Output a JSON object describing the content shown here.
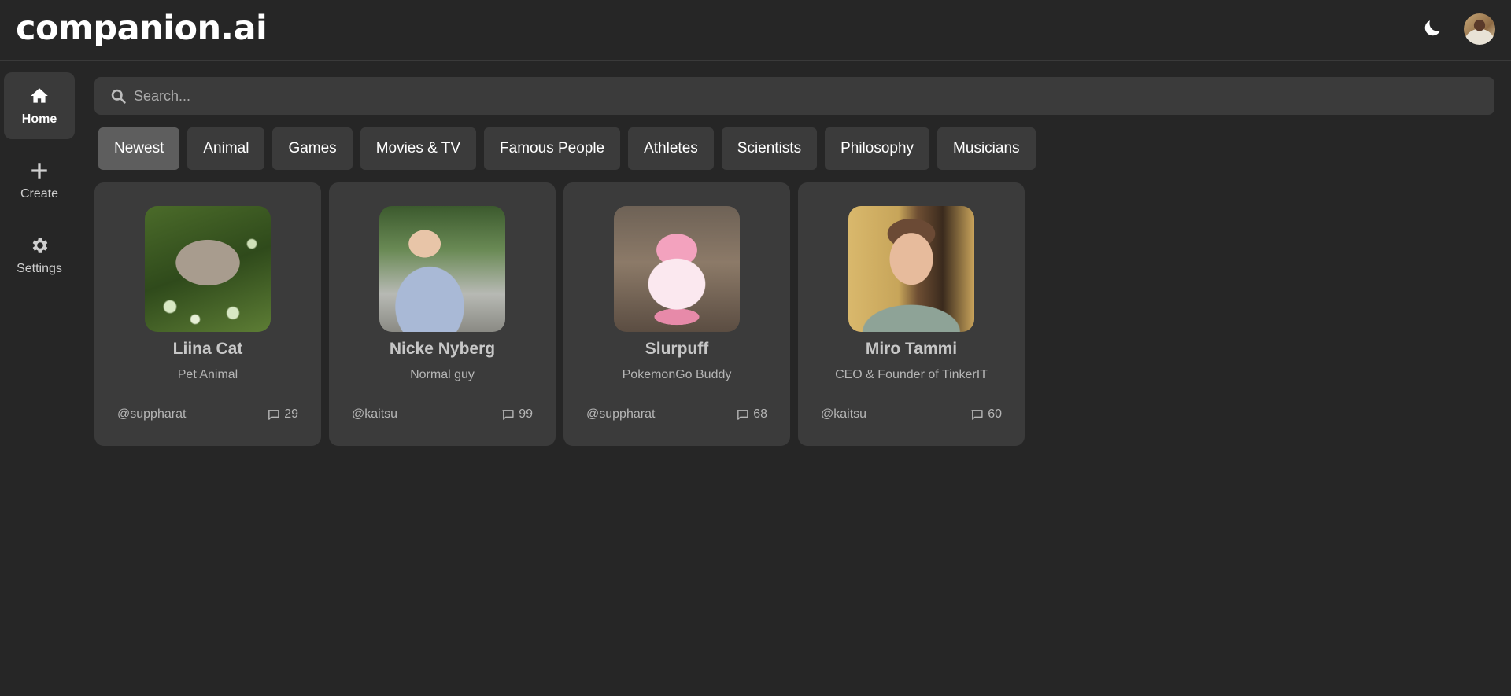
{
  "app": {
    "logo": "companion.ai"
  },
  "header": {
    "theme_icon": "moon-icon",
    "avatar_icon": "user-avatar"
  },
  "sidebar": {
    "items": [
      {
        "label": "Home",
        "icon": "home-icon",
        "active": true
      },
      {
        "label": "Create",
        "icon": "plus-icon",
        "active": false
      },
      {
        "label": "Settings",
        "icon": "gear-icon",
        "active": false
      }
    ]
  },
  "search": {
    "placeholder": "Search...",
    "value": ""
  },
  "categories": [
    {
      "label": "Newest",
      "active": true
    },
    {
      "label": "Animal"
    },
    {
      "label": "Games"
    },
    {
      "label": "Movies & TV"
    },
    {
      "label": "Famous People"
    },
    {
      "label": "Athletes"
    },
    {
      "label": "Scientists"
    },
    {
      "label": "Philosophy"
    },
    {
      "label": "Musicians"
    }
  ],
  "companions": [
    {
      "name": "Liina Cat",
      "description": "Pet Animal",
      "handle": "@suppharat",
      "messages": "29"
    },
    {
      "name": "Nicke Nyberg",
      "description": "Normal guy",
      "handle": "@kaitsu",
      "messages": "99"
    },
    {
      "name": "Slurpuff",
      "description": "PokemonGo Buddy",
      "handle": "@suppharat",
      "messages": "68"
    },
    {
      "name": "Miro Tammi",
      "description": "CEO & Founder of TinkerIT",
      "handle": "@kaitsu",
      "messages": "60"
    }
  ],
  "colors": {
    "background": "#262626",
    "surface": "#3b3b3b",
    "active_chip": "#5e5e5e"
  }
}
